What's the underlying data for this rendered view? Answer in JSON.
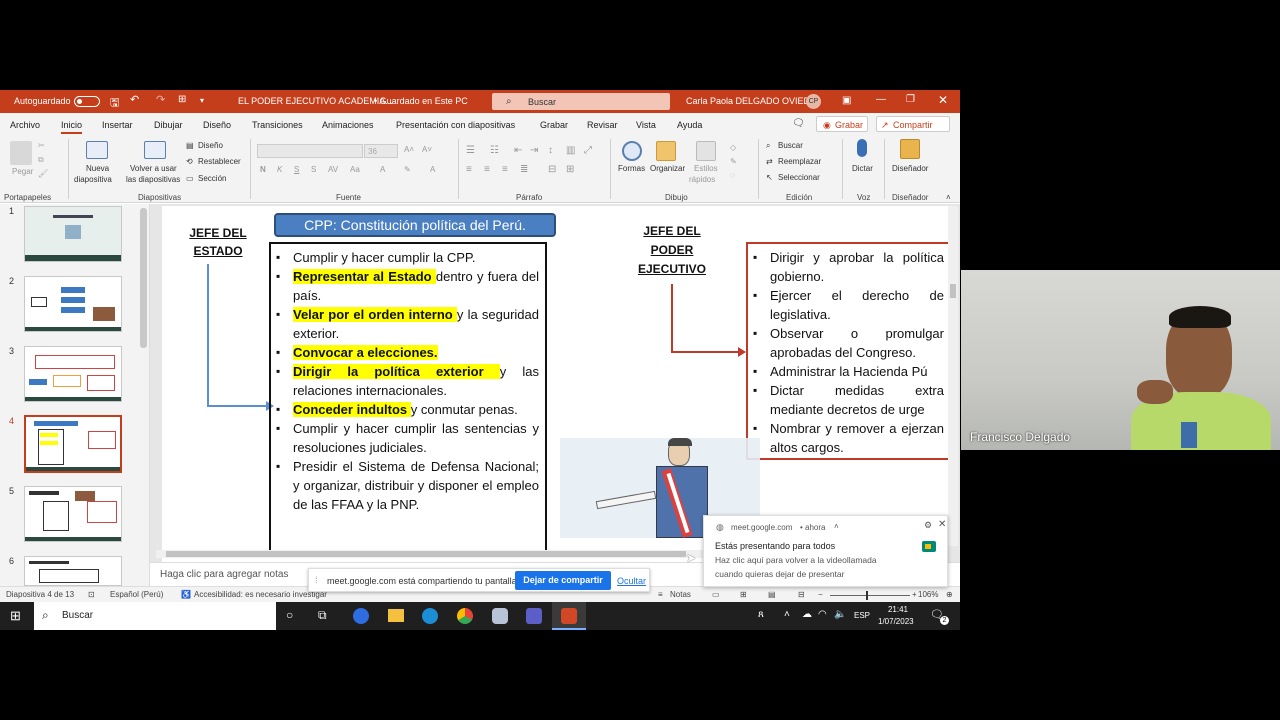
{
  "titlebar": {
    "autosave": "Autoguardado",
    "filename": "EL PODER EJECUTIVO ACADEMIA...",
    "saved": "• Guardado en Este PC",
    "search": "Buscar",
    "user": "Carla Paola DELGADO OVIEDO",
    "user_initials": "CP",
    "accent": "#c43e1c"
  },
  "menu": {
    "items": [
      "Archivo",
      "Inicio",
      "Insertar",
      "Dibujar",
      "Diseño",
      "Transiciones",
      "Animaciones",
      "Presentación con diapositivas",
      "Grabar",
      "Revisar",
      "Vista",
      "Ayuda"
    ],
    "grabar_button": "Grabar",
    "compartir_button": "Compartir"
  },
  "ribbon": {
    "pegar": "Pegar",
    "portapapeles": "Portapapeles",
    "nueva": "Nueva",
    "diapositiva": "diapositiva",
    "volver1": "Volver a usar",
    "volver2": "las diapositivas",
    "diseno": "Diseño",
    "restablecer": "Restablecer",
    "seccion": "Sección",
    "diapositivas": "Diapositivas",
    "font_size": "36",
    "fuente": "Fuente",
    "parrafo": "Párrafo",
    "formas": "Formas",
    "organizar": "Organizar",
    "estilos1": "Estilos",
    "estilos2": "rápidos",
    "dibujo": "Dibujo",
    "buscar": "Buscar",
    "reemplazar": "Reemplazar",
    "seleccionar": "Seleccionar",
    "edicion": "Edición",
    "dictar": "Dictar",
    "voz": "Voz",
    "disenador": "Diseñador",
    "disenador_group": "Diseñador"
  },
  "thumbnails": [
    "1",
    "2",
    "3",
    "4",
    "5",
    "6"
  ],
  "slide": {
    "header": "CPP: Constitución política del Perú.",
    "left_title_1": "JEFE DEL",
    "left_title_2": "ESTADO",
    "right_title_1": "JEFE DEL",
    "right_title_2": "PODER",
    "right_title_3": "EJECUTIVO",
    "left_items": [
      {
        "hl": "",
        "text": "Cumplir y hacer cumplir la CPP."
      },
      {
        "hl": "Representar al Estado ",
        "text": "dentro y fuera del país."
      },
      {
        "hl": "Velar por el orden interno ",
        "text": "y la seguridad exterior."
      },
      {
        "hl": "Convocar a elecciones.",
        "text": ""
      },
      {
        "hl": "Dirigir la política exterior ",
        "text": "y las relaciones internacionales."
      },
      {
        "hl": "Conceder indultos ",
        "text": "y conmutar penas."
      },
      {
        "hl": "",
        "text": "Cumplir y hacer cumplir las sentencias y resoluciones judiciales."
      },
      {
        "hl": "",
        "text": "Presidir el Sistema de Defensa Nacional; y organizar, distribuir y disponer el empleo de las FFAA y la PNP."
      }
    ],
    "right_items": [
      "Dirigir y aprobar la política gobierno.",
      "Ejercer el derecho de legislativa.",
      "Observar o promulgar aprobadas del Congreso.",
      "Administrar la Hacienda Pú",
      "Dictar medidas extra mediante decretos de urge",
      "Nombrar y remover a ejerzan altos cargos."
    ]
  },
  "notes_placeholder": "Haga clic para agregar notas",
  "status": {
    "slide": "Diapositiva 4 de 13",
    "lang": "Español (Perú)",
    "access": "Accesibilidad: es necesario investigar",
    "notas": "Notas",
    "zoom": "106%"
  },
  "sharebar": {
    "text": "meet.google.com está compartiendo tu pantalla.",
    "stop": "Dejar de compartir",
    "hide": "Ocultar"
  },
  "notification": {
    "source": "meet.google.com",
    "time": "• ahora",
    "title": "Estás presentando para todos",
    "body1": "Haz clic aquí para volver a la videollamada",
    "body2": "cuando quieras dejar de presentar"
  },
  "taskbar": {
    "search": "Buscar",
    "lang": "ESP",
    "time": "21:41",
    "date": "1/07/2023",
    "badge": "2"
  },
  "video": {
    "name": "Francisco Delgado"
  }
}
